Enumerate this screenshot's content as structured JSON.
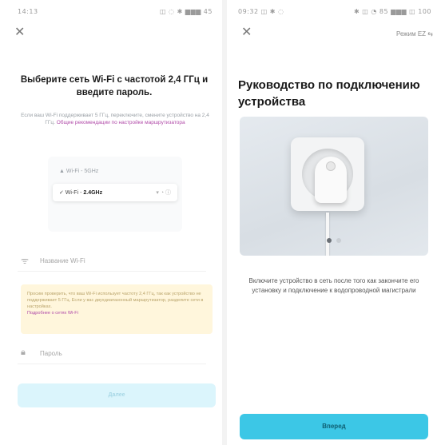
{
  "left": {
    "status_time": "14:13",
    "status_icons": "◫ ◌ ✱ ▆▆▆ 45",
    "title": "Выберите сеть Wi-Fi с частотой 2,4 ГГц и введите пароль.",
    "description": "Если ваш Wi-Fi поддерживает 5 ГГц, переключите, смените устройство на 2,4 ГГц.",
    "description_link": "Общие рекомендации по настройке маршрутизатора",
    "wifi_list": {
      "row1": "▲ Wi-Fi - 5GHz",
      "row2_prefix": "✓ Wi-Fi - ",
      "row2_band": "2.4GHz",
      "row2_icons": "▾ ◔ ⓘ",
      "row3": " "
    },
    "ssid_placeholder": "Название Wi-Fi",
    "warning_text": "Просим проверить, что ваш Wi-Fi использует частоту 2,4 ГГц, так как устройство не поддерживает 5 ГГц. Если у вас двухдиапазонный маршрутизатор, разделите сети в настройках.",
    "warning_link": "Подробнее о сетях Wi-Fi",
    "password_placeholder": "Пароль",
    "next_label": "Далее"
  },
  "right": {
    "status_time": "09:32 ◫ ✱ ◌",
    "status_icons": "✱ ◫ ◔ 85 ▆▆▆ ◫ 100",
    "mode_link": "Режим EZ ⇆",
    "title": "Руководство по подключению устройства",
    "description": "Включите устройство в сеть после того как закончите его установку и подключение к водопроводной магистрали",
    "next_label": "Вперед"
  },
  "icons": {
    "close": "close-icon",
    "wifi": "wifi-icon",
    "lock": "lock-icon"
  },
  "colors": {
    "accent": "#3cc7e6",
    "link": "#b04aa8",
    "warning_bg": "#fff6dc"
  }
}
